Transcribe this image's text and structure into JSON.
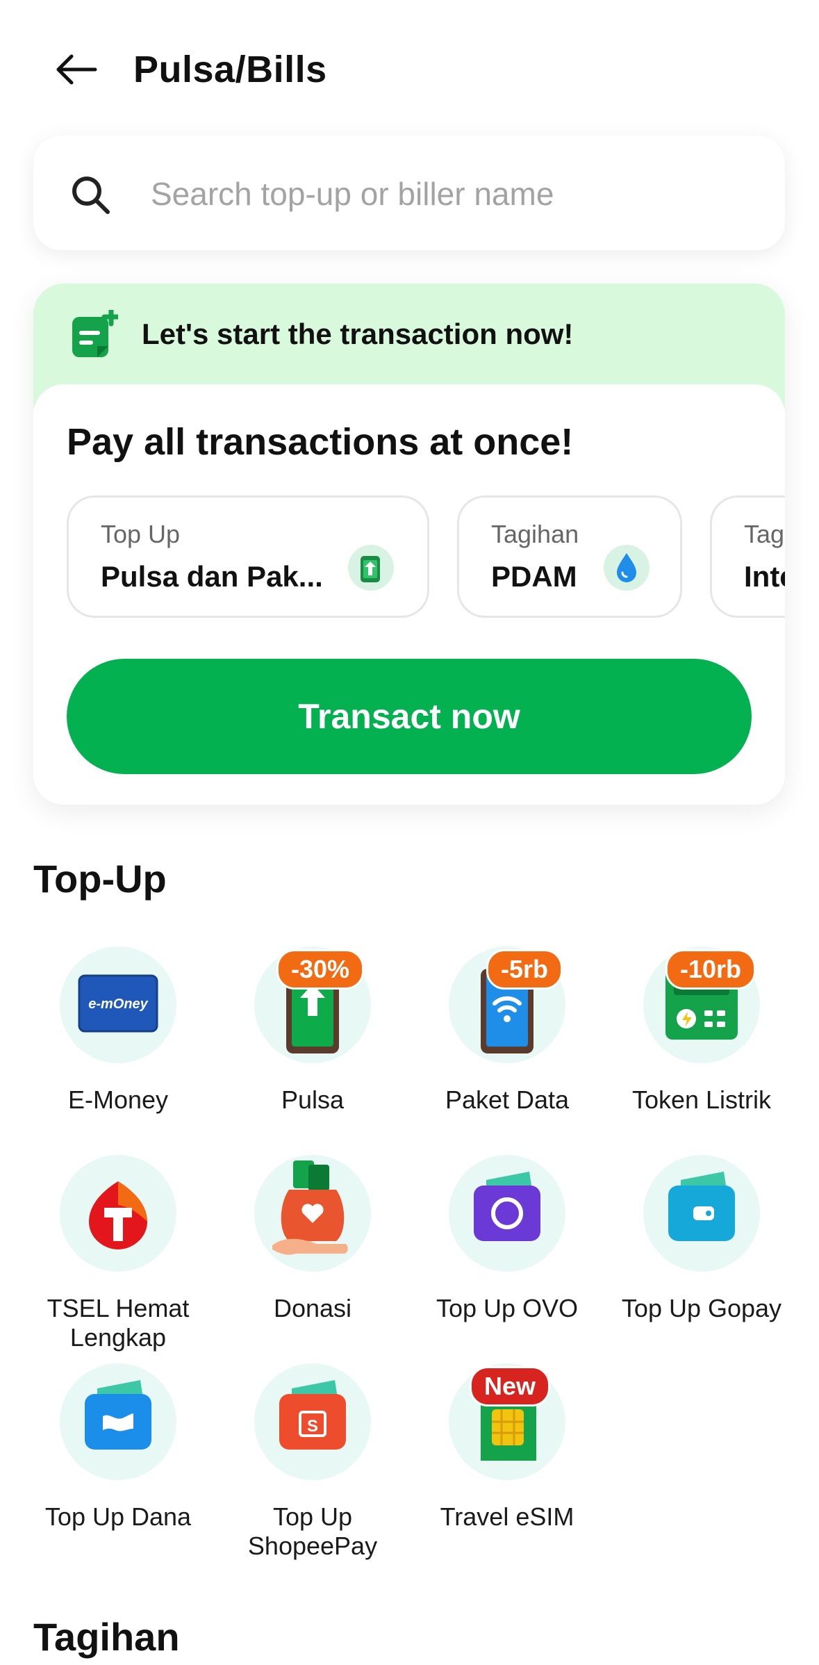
{
  "header": {
    "title": "Pulsa/Bills"
  },
  "search": {
    "placeholder": "Search top-up or biller name"
  },
  "promo": {
    "banner_text": "Let's start the transaction now!",
    "heading": "Pay all transactions at once!",
    "chips": [
      {
        "label": "Top Up",
        "value": "Pulsa dan Pak...",
        "icon": "phone-arrow-icon"
      },
      {
        "label": "Tagihan",
        "value": "PDAM",
        "icon": "water-drop-icon"
      },
      {
        "label": "Tag",
        "value": "Inte",
        "icon": ""
      }
    ],
    "button_label": "Transact now"
  },
  "topup": {
    "title": "Top-Up",
    "items": [
      {
        "label": "E-Money",
        "badge": "",
        "icon": "emoney-card-icon"
      },
      {
        "label": "Pulsa",
        "badge": "-30%",
        "badge_color": "#f26a12",
        "icon": "pulsa-phone-icon"
      },
      {
        "label": "Paket Data",
        "badge": "-5rb",
        "badge_color": "#f26a12",
        "icon": "data-phone-icon"
      },
      {
        "label": "Token Listrik",
        "badge": "-10rb",
        "badge_color": "#f26a12",
        "icon": "electricity-token-icon"
      },
      {
        "label": "TSEL Hemat Lengkap",
        "badge": "",
        "icon": "telkomsel-icon"
      },
      {
        "label": "Donasi",
        "badge": "",
        "icon": "donation-icon"
      },
      {
        "label": "Top Up OVO",
        "badge": "",
        "icon": "ovo-wallet-icon"
      },
      {
        "label": "Top Up Gopay",
        "badge": "",
        "icon": "gopay-wallet-icon"
      },
      {
        "label": "Top Up Dana",
        "badge": "",
        "icon": "dana-wallet-icon"
      },
      {
        "label": "Top Up ShopeePay",
        "badge": "",
        "icon": "shopeepay-wallet-icon"
      },
      {
        "label": "Travel eSIM",
        "badge": "New",
        "badge_color": "#d8241f",
        "icon": "esim-card-icon"
      }
    ]
  },
  "tagihan": {
    "title": "Tagihan"
  },
  "colors": {
    "primary": "#03b150",
    "banner_bg": "#d9f9dd",
    "icon_bg": "#e7f8f5",
    "discount_badge": "#f26a12",
    "new_badge": "#d8241f"
  }
}
